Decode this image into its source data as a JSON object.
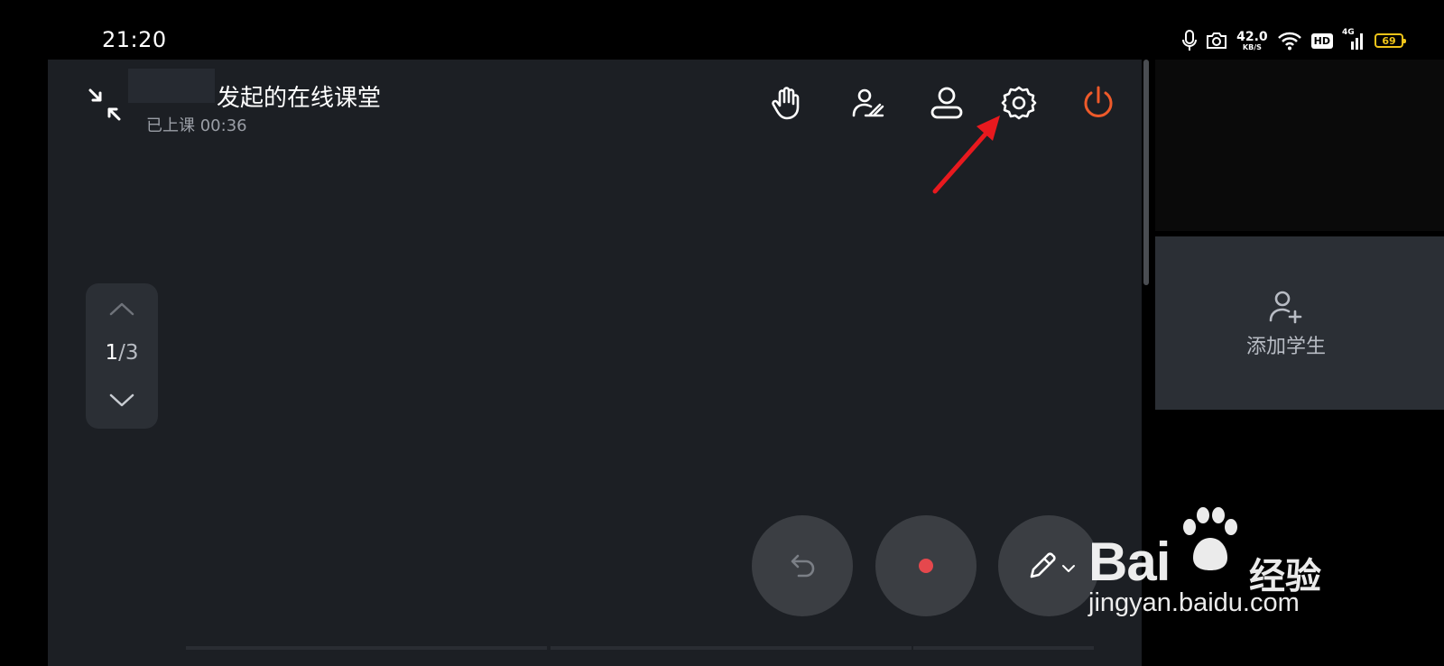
{
  "status_bar": {
    "time": "21:20",
    "net_speed_value": "42.0",
    "net_speed_unit": "KB/S",
    "hd_label": "HD",
    "signal_label": "4G",
    "battery_level": "69",
    "icons": [
      "microphone-icon",
      "camera-icon",
      "wifi-icon",
      "hd-icon",
      "cell-signal-icon",
      "battery-icon"
    ]
  },
  "header": {
    "title": "发起的在线课堂",
    "status": "已上课 00:36",
    "actions": [
      "raise-hand-icon",
      "member-manage-icon",
      "user-icon",
      "settings-icon",
      "power-icon"
    ]
  },
  "pager": {
    "current": "1",
    "separator": "/",
    "total": "3"
  },
  "side_panel": {
    "add_student_label": "添加学生"
  },
  "toolbar": {
    "buttons": [
      "undo-icon",
      "record-icon",
      "pen-icon"
    ]
  },
  "watermark": {
    "brand": "Bai",
    "brand_suffix": "经验",
    "url": "jingyan.baidu.com"
  },
  "colors": {
    "background": "#1c1f24",
    "panel": "#2b2f35",
    "power": "#ee5a2a",
    "record_dot": "#e5484d",
    "annotation": "#e8191e",
    "battery": "#f0c419"
  }
}
